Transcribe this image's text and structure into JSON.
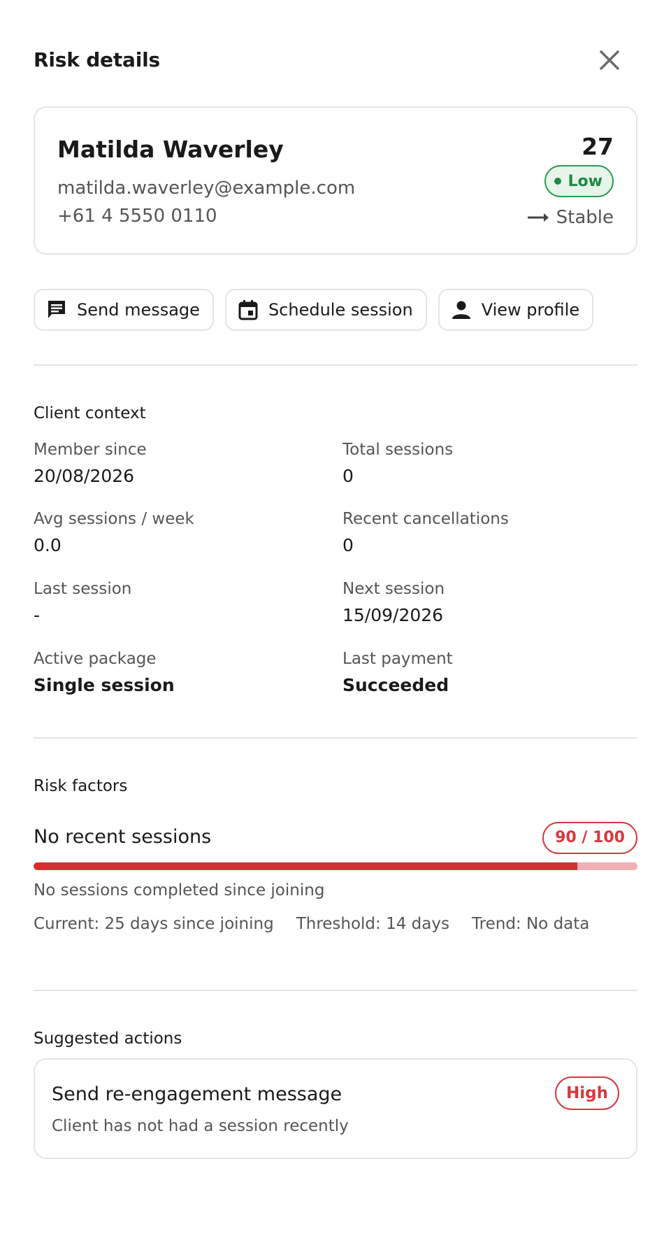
{
  "header": {
    "title": "Risk details",
    "close_icon": "close-icon"
  },
  "client": {
    "name": "Matilda Waverley",
    "email": "matilda.waverley@example.com",
    "phone": "+61 4 5550 0110",
    "risk_score": "27",
    "risk_level": "Low",
    "trend_label": "Stable",
    "trend_icon": "arrow-right-icon",
    "level_color": "#1e8a45"
  },
  "actions": [
    {
      "label": "Send message",
      "icon": "message-icon"
    },
    {
      "label": "Schedule session",
      "icon": "calendar-icon"
    },
    {
      "label": "View profile",
      "icon": "person-icon"
    }
  ],
  "context": {
    "title": "Client context",
    "items": [
      {
        "label": "Member since",
        "value": "20/08/2026"
      },
      {
        "label": "Total sessions",
        "value": "0"
      },
      {
        "label": "Avg sessions / week",
        "value": "0.0"
      },
      {
        "label": "Recent cancellations",
        "value": "0"
      },
      {
        "label": "Last session",
        "value": "-"
      },
      {
        "label": "Next session",
        "value": "15/09/2026"
      },
      {
        "label": "Active package",
        "value": "Single session"
      },
      {
        "label": "Last payment",
        "value": "Succeeded"
      }
    ]
  },
  "risk_factors": {
    "title": "Risk factors",
    "items": [
      {
        "name": "No recent sessions",
        "score_label": "90 / 100",
        "score": 90,
        "max": 100,
        "description": "No sessions completed since joining",
        "current": "Current: 25 days since joining",
        "threshold": "Threshold: 14 days",
        "trend": "Trend: No data"
      }
    ]
  },
  "suggested": {
    "title": "Suggested actions",
    "items": [
      {
        "title": "Send re-engagement message",
        "description": "Client has not had a session recently",
        "priority": "High"
      }
    ]
  },
  "colors": {
    "danger": "#d32f2f",
    "success": "#1e8a45",
    "border": "#e4e4e4"
  }
}
